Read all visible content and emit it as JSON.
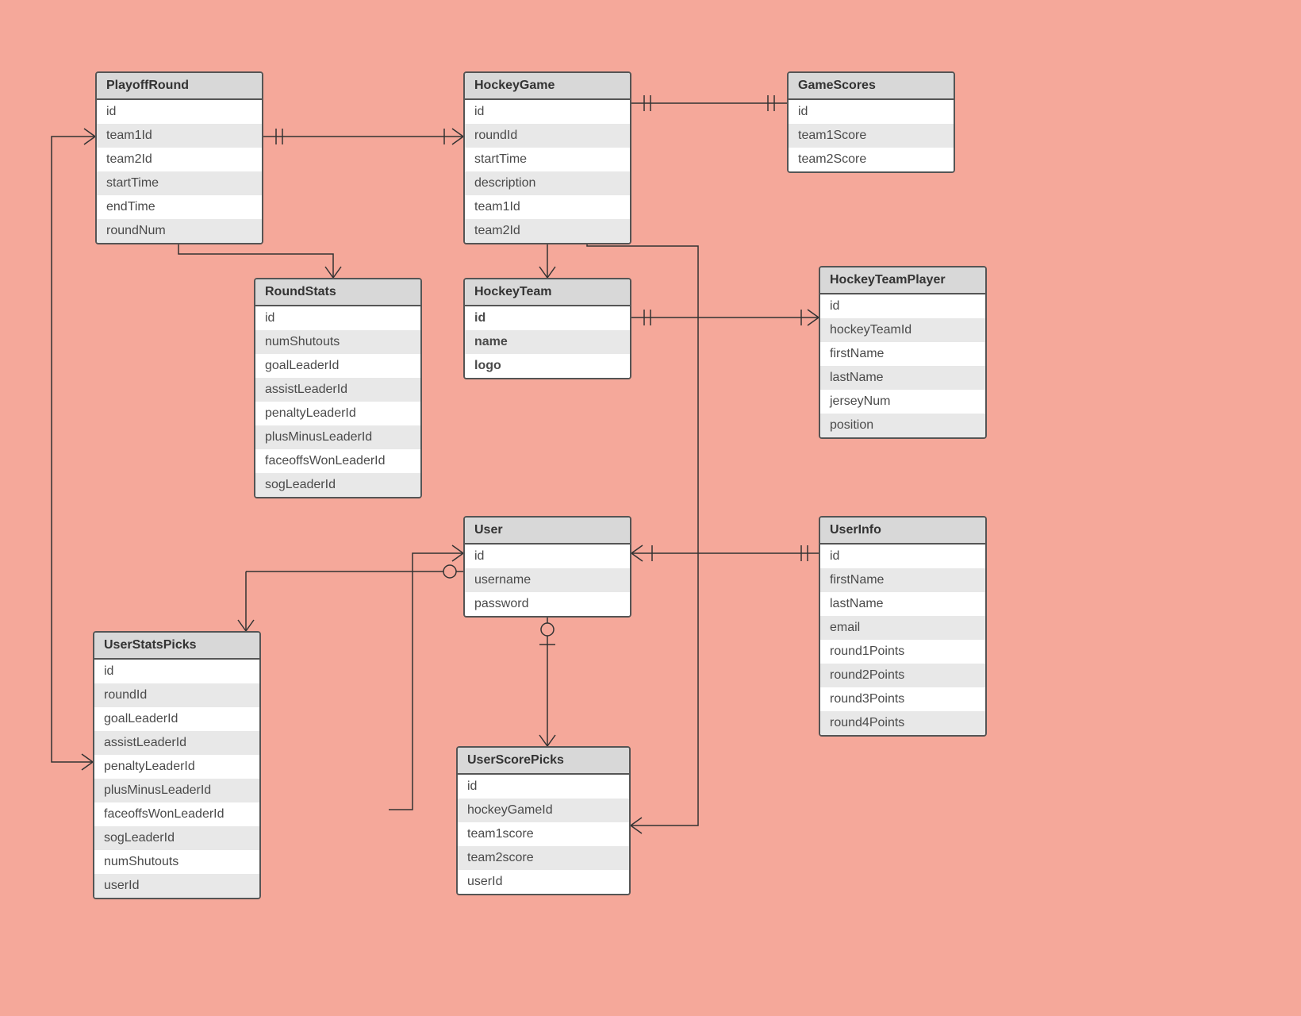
{
  "entities": {
    "playoffRound": {
      "title": "PlayoffRound",
      "fields": [
        "id",
        "team1Id",
        "team2Id",
        "startTime",
        "endTime",
        "roundNum"
      ]
    },
    "hockeyGame": {
      "title": "HockeyGame",
      "fields": [
        "id",
        "roundId",
        "startTime",
        "description",
        "team1Id",
        "team2Id"
      ]
    },
    "gameScores": {
      "title": "GameScores",
      "fields": [
        "id",
        "team1Score",
        "team2Score"
      ]
    },
    "roundStats": {
      "title": "RoundStats",
      "fields": [
        "id",
        "numShutouts",
        "goalLeaderId",
        "assistLeaderId",
        "penaltyLeaderId",
        "plusMinusLeaderId",
        "faceoffsWonLeaderId",
        "sogLeaderId"
      ]
    },
    "hockeyTeam": {
      "title": "HockeyTeam",
      "fields": [
        "id",
        "name",
        "logo"
      ],
      "boldFields": true
    },
    "hockeyTeamPlayer": {
      "title": "HockeyTeamPlayer",
      "fields": [
        "id",
        "hockeyTeamId",
        "firstName",
        "lastName",
        "jerseyNum",
        "position"
      ]
    },
    "user": {
      "title": "User",
      "fields": [
        "id",
        "username",
        "password"
      ]
    },
    "userInfo": {
      "title": "UserInfo",
      "fields": [
        "id",
        "firstName",
        "lastName",
        "email",
        "round1Points",
        "round2Points",
        "round3Points",
        "round4Points"
      ]
    },
    "userStatsPicks": {
      "title": "UserStatsPicks",
      "fields": [
        "id",
        "roundId",
        "goalLeaderId",
        "assistLeaderId",
        "penaltyLeaderId",
        "plusMinusLeaderId",
        "faceoffsWonLeaderId",
        "sogLeaderId",
        "numShutouts",
        "userId"
      ]
    },
    "userScorePicks": {
      "title": "UserScorePicks",
      "fields": [
        "id",
        "hockeyGameId",
        "team1score",
        "team2score",
        "userId"
      ]
    }
  }
}
